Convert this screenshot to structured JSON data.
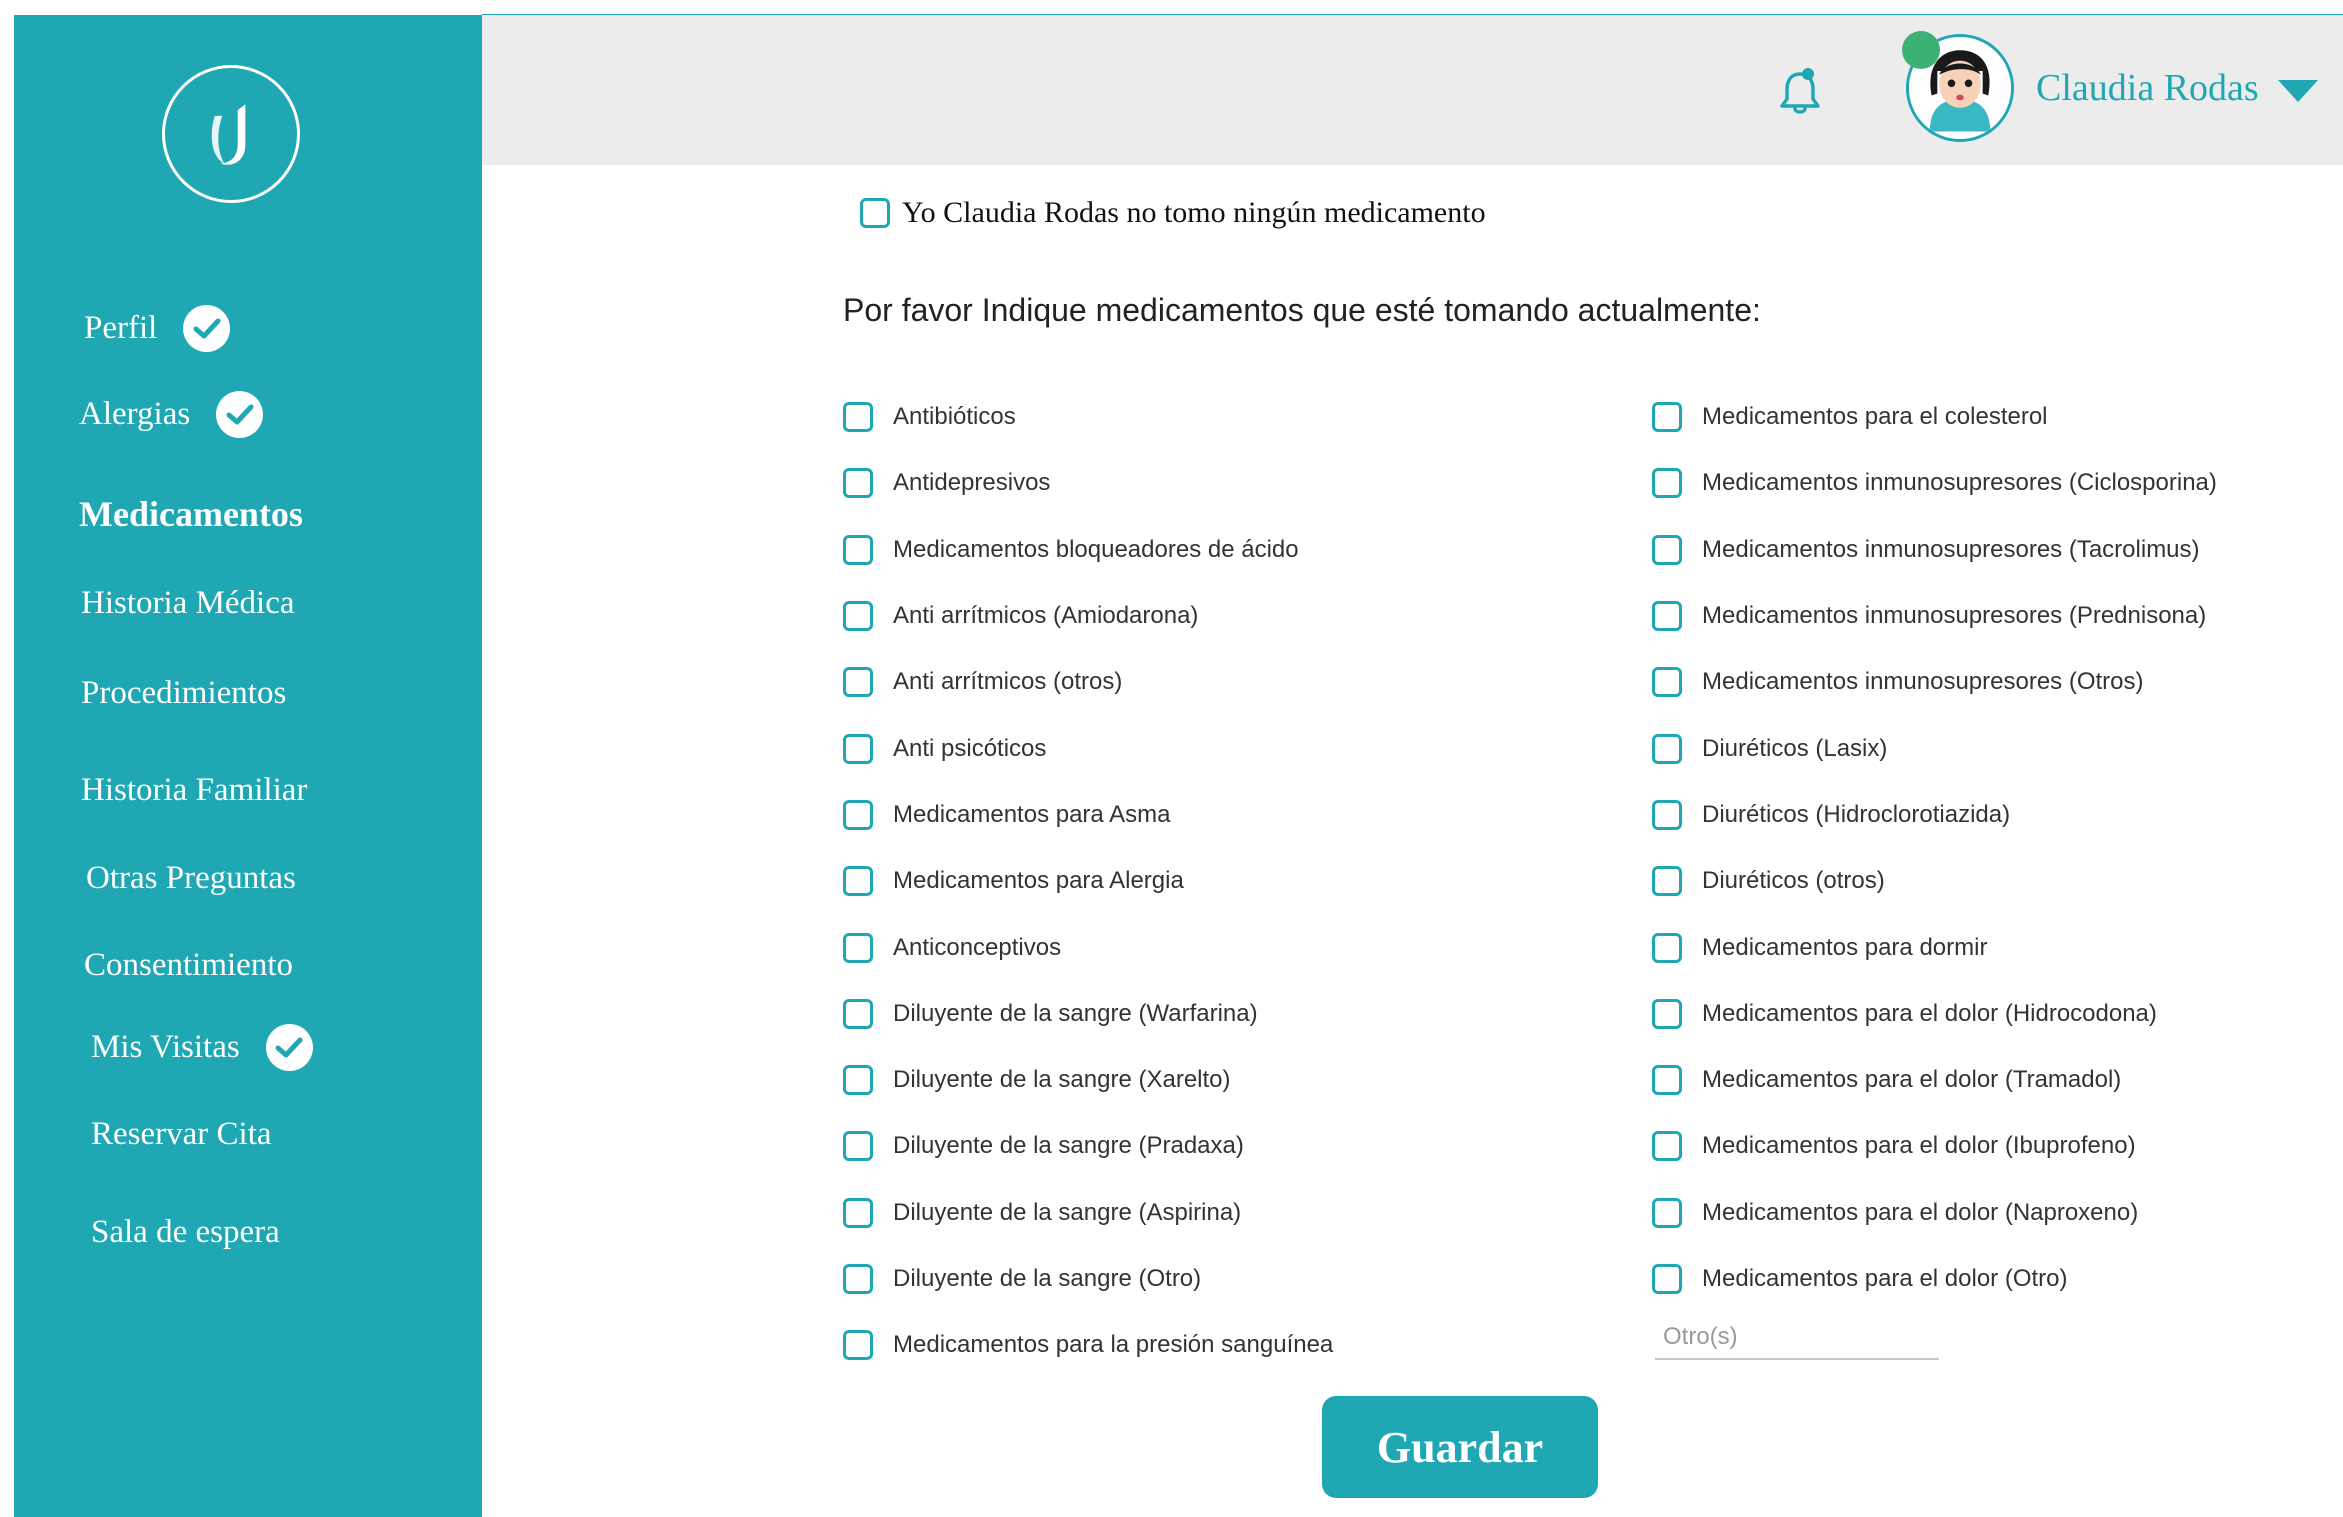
{
  "colors": {
    "accent": "#1fa8b4",
    "topbar_bg": "#ececec",
    "status_online": "#3bb273"
  },
  "sidebar": {
    "logo_icon": "app-logo",
    "items": [
      {
        "label": "Perfil",
        "completed": true,
        "active": false
      },
      {
        "label": "Alergias",
        "completed": true,
        "active": false
      },
      {
        "label": "Medicamentos",
        "completed": false,
        "active": true
      },
      {
        "label": "Historia Médica",
        "completed": false,
        "active": false
      },
      {
        "label": "Procedimientos",
        "completed": false,
        "active": false
      },
      {
        "label": "Historia Familiar",
        "completed": false,
        "active": false
      },
      {
        "label": "Otras Preguntas",
        "completed": false,
        "active": false
      },
      {
        "label": "Consentimiento",
        "completed": false,
        "active": false
      },
      {
        "label": "Mis Visitas",
        "completed": true,
        "active": false
      },
      {
        "label": "Reservar Cita",
        "completed": false,
        "active": false
      },
      {
        "label": "Sala de espera",
        "completed": false,
        "active": false
      }
    ]
  },
  "header": {
    "notification_icon": "bell-icon",
    "user_name": "Claudia Rodas",
    "user_menu_icon": "caret-down-icon"
  },
  "form": {
    "no_medication_label": "Yo Claudia Rodas  no tomo ningún medicamento",
    "prompt": "Por favor Indique medicamentos que esté tomando actualmente:",
    "options_left": [
      "Antibióticos",
      "Antidepresivos",
      "Medicamentos bloqueadores de ácido",
      "Anti arrítmicos (Amiodarona)",
      "Anti arrítmicos (otros)",
      "Anti psicóticos",
      "Medicamentos para Asma",
      "Medicamentos para Alergia",
      "Anticonceptivos",
      "Diluyente de la sangre (Warfarina)",
      "Diluyente de la sangre (Xarelto)",
      "Diluyente de la sangre (Pradaxa)",
      "Diluyente de la sangre (Aspirina)",
      "Diluyente de la sangre (Otro)",
      "Medicamentos para la presión sanguínea"
    ],
    "options_right": [
      "Medicamentos para el colesterol",
      "Medicamentos inmunosupresores (Ciclosporina)",
      "Medicamentos inmunosupresores (Tacrolimus)",
      "Medicamentos inmunosupresores (Prednisona)",
      "Medicamentos inmunosupresores (Otros)",
      "Diuréticos (Lasix)",
      "Diuréticos (Hidroclorotiazida)",
      "Diuréticos (otros)",
      "Medicamentos para dormir",
      "Medicamentos para el dolor (Hidrocodona)",
      "Medicamentos para el dolor (Tramadol)",
      "Medicamentos para el dolor (Ibuprofeno)",
      "Medicamentos para el dolor (Naproxeno)",
      "Medicamentos para el dolor (Otro)"
    ],
    "other_placeholder": "Otro(s)",
    "other_value": "",
    "save_label": "Guardar"
  }
}
